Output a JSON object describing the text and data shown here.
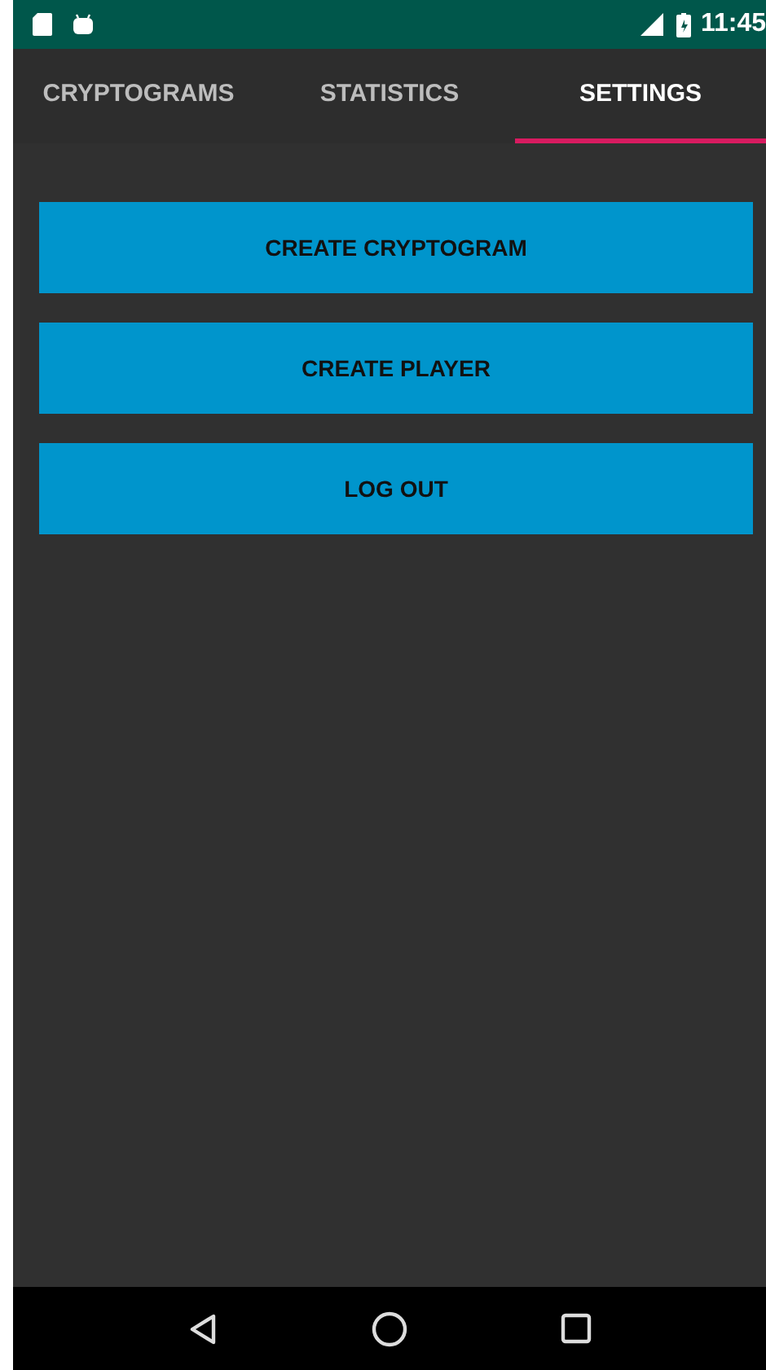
{
  "status_bar": {
    "time": "11:45"
  },
  "tabs": [
    {
      "label": "CRYPTOGRAMS",
      "selected": false
    },
    {
      "label": "STATISTICS",
      "selected": false
    },
    {
      "label": "SETTINGS",
      "selected": true
    }
  ],
  "buttons": [
    "CREATE CRYPTOGRAM",
    "CREATE PLAYER",
    "LOG OUT"
  ]
}
